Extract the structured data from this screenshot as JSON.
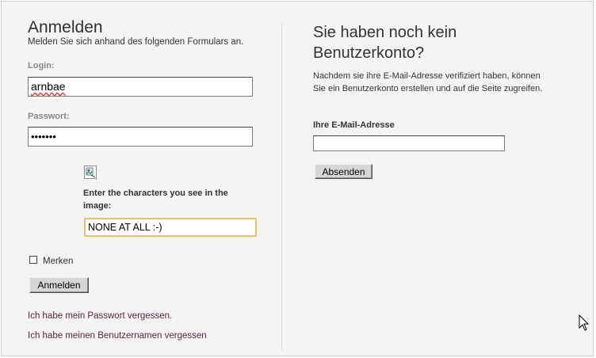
{
  "login_panel": {
    "title": "Anmelden",
    "subtitle": "Melden Sie sich anhand des folgenden Formulars an.",
    "login_label": "Login:",
    "login_value": "arnbae",
    "password_label": "Passwort:",
    "password_value": "•••••••",
    "captcha_icon": "broken-image-icon",
    "captcha_prompt": "Enter the characters you see in the image:",
    "captcha_value": "NONE AT ALL :-)",
    "remember_label": "Merken",
    "remember_checked": false,
    "submit_label": "Anmelden",
    "forgot_password_link": "Ich habe mein Passwort vergessen.",
    "forgot_username_link": "Ich habe meinen Benutzernamen vergessen"
  },
  "register_panel": {
    "title": "Sie haben noch kein Benutzerkonto?",
    "description": "Nachdem sie ihre E-Mail-Adresse verifiziert haben, können Sie ein Benutzerkonto erstellen und auf die Seite zugreifen.",
    "email_label": "Ihre E-Mail-Adresse",
    "email_value": "",
    "submit_label": "Absenden"
  },
  "cursor_icon": "mouse-pointer-icon"
}
